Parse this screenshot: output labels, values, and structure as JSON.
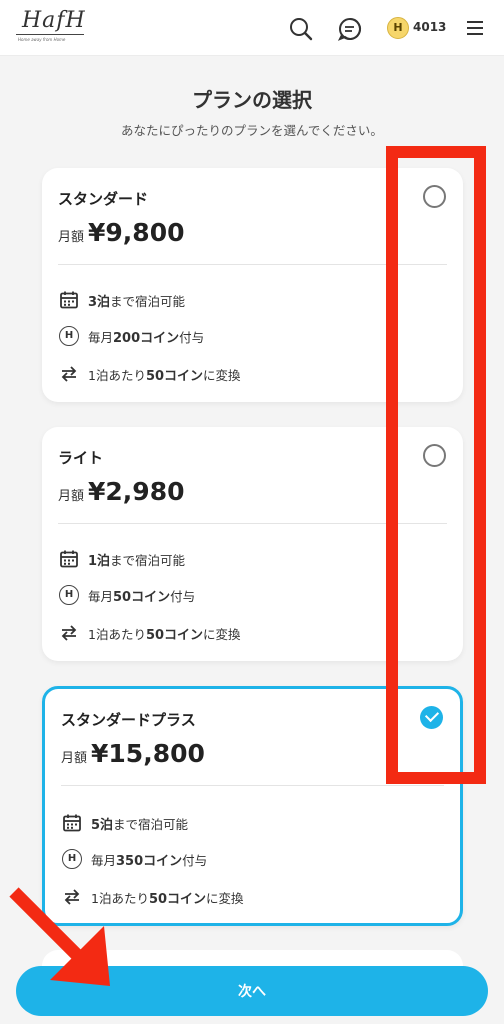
{
  "header": {
    "logo_text": "HafH",
    "logo_tagline": "Home away from Home",
    "coin_symbol": "H",
    "coin_count": "4013"
  },
  "page": {
    "title": "プランの選択",
    "subtitle": "あなたにぴったりのプランを選んでください。"
  },
  "plans": [
    {
      "name": "スタンダード",
      "price_label": "月額",
      "price": "¥9,800",
      "selected": false,
      "nights_value": "3泊",
      "nights_text": "まで宿泊可能",
      "coins_prefix": "毎月",
      "coins_value": "200コイン",
      "coins_suffix": "付与",
      "convert_prefix": "1泊あたり",
      "convert_value": "50コイン",
      "convert_suffix": "に変換"
    },
    {
      "name": "ライト",
      "price_label": "月額",
      "price": "¥2,980",
      "selected": false,
      "nights_value": "1泊",
      "nights_text": "まで宿泊可能",
      "coins_prefix": "毎月",
      "coins_value": "50コイン",
      "coins_suffix": "付与",
      "convert_prefix": "1泊あたり",
      "convert_value": "50コイン",
      "convert_suffix": "に変換"
    },
    {
      "name": "スタンダードプラス",
      "price_label": "月額",
      "price": "¥15,800",
      "selected": true,
      "nights_value": "5泊",
      "nights_text": "まで宿泊可能",
      "coins_prefix": "毎月",
      "coins_value": "350コイン",
      "coins_suffix": "付与",
      "convert_prefix": "1泊あたり",
      "convert_value": "50コイン",
      "convert_suffix": "に変換"
    }
  ],
  "footer": {
    "next_label": "次へ"
  },
  "colors": {
    "accent": "#1eb3e8",
    "annotation_red": "#f32a13"
  }
}
